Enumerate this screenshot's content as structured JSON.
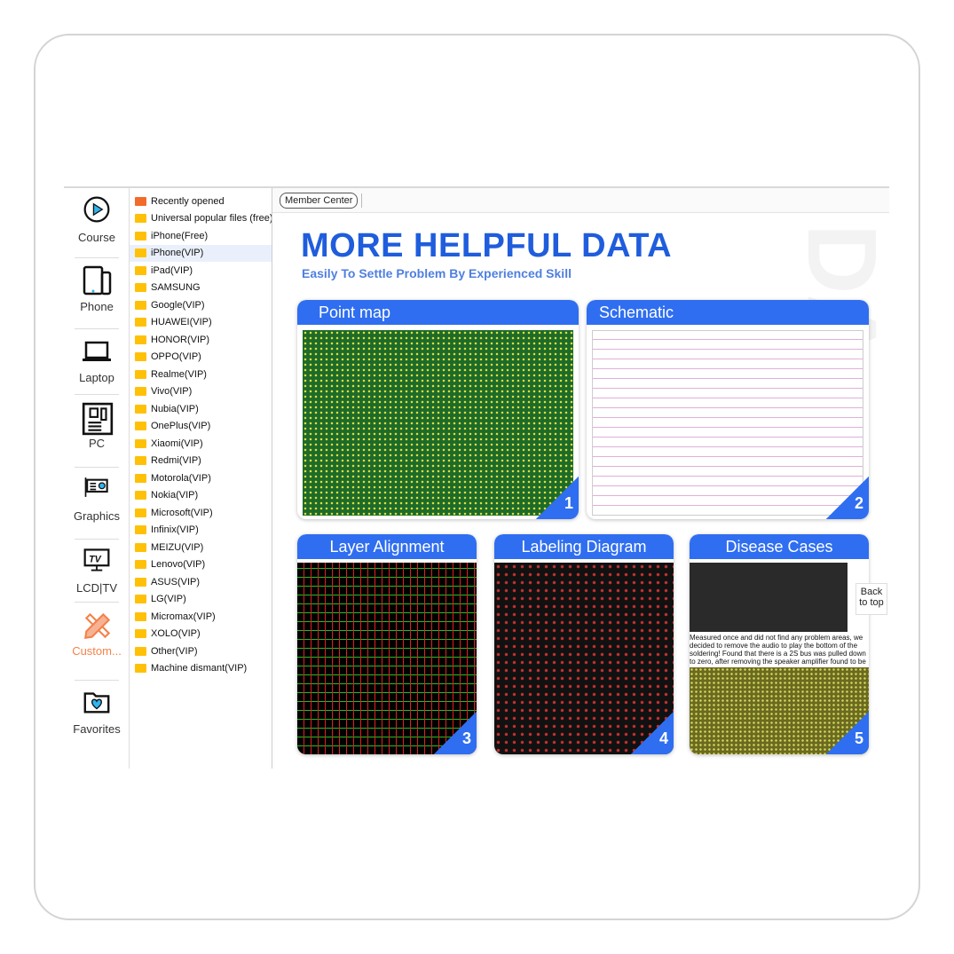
{
  "nav": [
    {
      "label": "Course",
      "icon": "play-circle-icon"
    },
    {
      "label": "Phone",
      "icon": "phone-tablet-icon"
    },
    {
      "label": "Laptop",
      "icon": "laptop-icon"
    },
    {
      "label": "PC",
      "icon": "motherboard-icon"
    },
    {
      "label": "Graphics",
      "icon": "graphics-card-icon"
    },
    {
      "label": "LCD|TV",
      "icon": "tv-icon"
    },
    {
      "label": "Custom...",
      "icon": "pencil-ruler-icon",
      "active": true
    },
    {
      "label": "Favorites",
      "icon": "heart-folder-icon"
    }
  ],
  "files": [
    "Recently opened",
    "Universal popular files (free)",
    "iPhone(Free)",
    "iPhone(VIP)",
    "iPad(VIP)",
    "SAMSUNG",
    "Google(VIP)",
    "HUAWEI(VIP)",
    "HONOR(VIP)",
    "OPPO(VIP)",
    "Realme(VIP)",
    "Vivo(VIP)",
    "Nubia(VIP)",
    "OnePlus(VIP)",
    "Xiaomi(VIP)",
    "Redmi(VIP)",
    "Motorola(VIP)",
    "Nokia(VIP)",
    "Microsoft(VIP)",
    "Infinix(VIP)",
    "MEIZU(VIP)",
    "Lenovo(VIP)",
    "ASUS(VIP)",
    "LG(VIP)",
    "Micromax(VIP)",
    "XOLO(VIP)",
    "Other(VIP)",
    "Machine dismant(VIP)"
  ],
  "selected_file": "iPhone(VIP)",
  "toolbar": {
    "member_center": "Member Center"
  },
  "banner": {
    "title": "MORE HELPFUL DATA",
    "subtitle": "Easily To Settle Problem By Experienced Skill"
  },
  "cards": [
    {
      "title": "Point map",
      "num": "1"
    },
    {
      "title": "Schematic",
      "num": "2"
    },
    {
      "title": "Layer Alignment",
      "num": "3"
    },
    {
      "title": "Labeling Diagram",
      "num": "4"
    },
    {
      "title": "Disease Cases",
      "num": "5"
    }
  ],
  "disease_text": "Measured once and did not find any problem areas, we decided to remove the audio to play the bottom of the soldering! Found that there is a 2S bus was pulled down to zero, after removing the speaker amplifier found to be the bottom of the tin even!",
  "back_to_top": "Back to top",
  "colors": {
    "accent": "#2f6ef0",
    "title": "#1f5ddc",
    "active_nav": "#f4824a",
    "folder": "#ffc107"
  }
}
